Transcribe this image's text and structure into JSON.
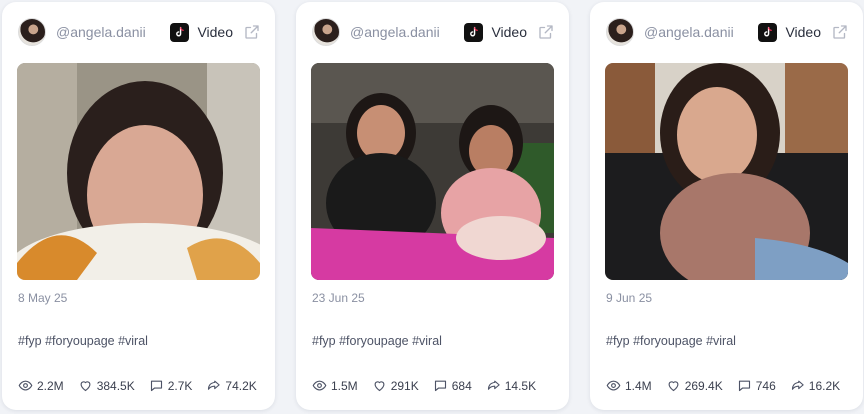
{
  "posts": [
    {
      "handle": "@angela.danii",
      "platform": "Video",
      "date": "8 May 25",
      "caption": "#fyp #foryoupage #viral",
      "stats": {
        "views": "2.2M",
        "likes": "384.5K",
        "comments": "2.7K",
        "shares": "74.2K"
      }
    },
    {
      "handle": "@angela.danii",
      "platform": "Video",
      "date": "23 Jun 25",
      "caption": "#fyp #foryoupage #viral",
      "stats": {
        "views": "1.5M",
        "likes": "291K",
        "comments": "684",
        "shares": "14.5K"
      }
    },
    {
      "handle": "@angela.danii",
      "platform": "Video",
      "date": "9 Jun 25",
      "caption": "#fyp #foryoupage #viral",
      "stats": {
        "views": "1.4M",
        "likes": "269.4K",
        "comments": "746",
        "shares": "16.2K"
      }
    }
  ],
  "icons": {
    "platform": "tiktok-icon",
    "external": "external-link-icon",
    "views": "eye-icon",
    "likes": "heart-icon",
    "comments": "comment-icon",
    "shares": "share-icon"
  },
  "colors": {
    "background": "#f1f3f7",
    "card": "#ffffff",
    "muted_text": "#8a90a2",
    "body_text": "#3a3f4e"
  }
}
